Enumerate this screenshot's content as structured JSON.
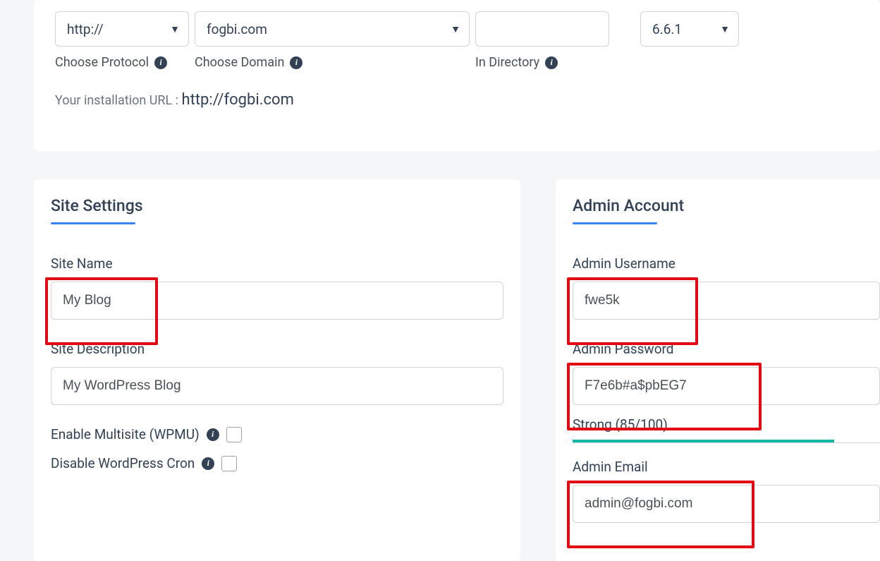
{
  "top": {
    "protocol": "http://",
    "domain": "fogbi.com",
    "directory": "",
    "version": "6.6.1",
    "protocol_label": "Choose Protocol",
    "domain_label": "Choose Domain",
    "directory_label": "In Directory",
    "url_prefix": "Your installation URL : ",
    "url": "http://fogbi.com"
  },
  "site": {
    "title": "Site Settings",
    "name_label": "Site Name",
    "name_value": "My Blog",
    "desc_label": "Site Description",
    "desc_value": "My WordPress Blog",
    "multisite_label": "Enable Multisite (WPMU)",
    "cron_label": "Disable WordPress Cron"
  },
  "admin": {
    "title": "Admin Account",
    "user_label": "Admin Username",
    "user_value": "fwe5k",
    "pass_label": "Admin Password",
    "pass_value": "F7e6b#a$pbEG7",
    "strength_label": "Strong (85/100)",
    "email_label": "Admin Email",
    "email_value": "admin@fogbi.com"
  }
}
